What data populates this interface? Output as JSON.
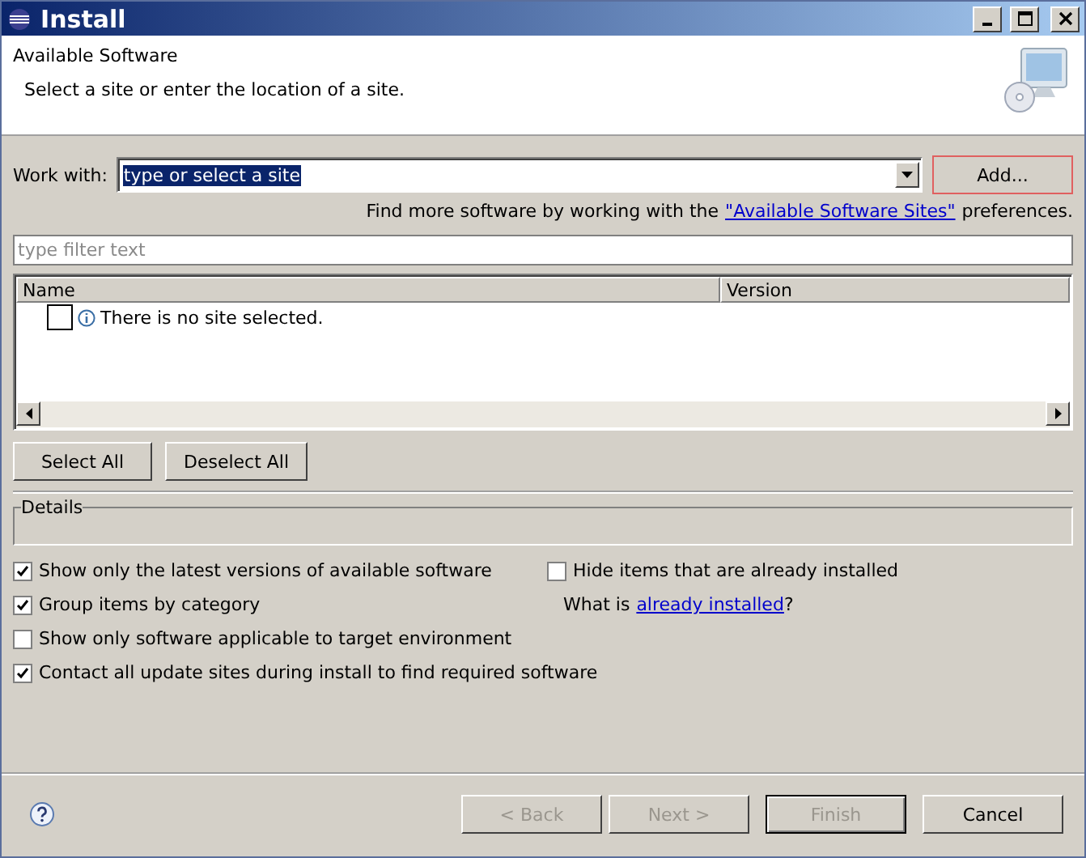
{
  "window": {
    "title": "Install"
  },
  "header": {
    "title": "Available Software",
    "description": "Select a site or enter the location of a site."
  },
  "work_with": {
    "label": "Work with:",
    "value": "type or select a site",
    "add_button": "Add..."
  },
  "more_software": {
    "before": "Find more software by working with the",
    "link": "\"Available Software Sites\"",
    "after": "preferences."
  },
  "filter": {
    "placeholder": "type filter text"
  },
  "table": {
    "columns": [
      "Name",
      "Version"
    ],
    "rows": [
      {
        "name": "There is no site selected.",
        "checked": false
      }
    ]
  },
  "selection_buttons": [
    "Select All",
    "Deselect All"
  ],
  "details": {
    "label": "Details"
  },
  "options": [
    {
      "label": "Show only the latest versions of available software",
      "checked": true
    },
    {
      "label": "Hide items that are already installed",
      "checked": false
    },
    {
      "label": "Group items by category",
      "checked": true
    },
    {
      "label": "Show only software applicable to target environment",
      "checked": false
    },
    {
      "label": "Contact all update sites during install to find required software",
      "checked": true
    }
  ],
  "installed_note": {
    "before": "What is",
    "link": "already installed",
    "after": "?"
  },
  "buttons": [
    {
      "label": "< Back",
      "disabled": true,
      "default": false
    },
    {
      "label": "Next >",
      "disabled": true,
      "default": false
    },
    {
      "label": "Finish",
      "disabled": true,
      "default": true
    },
    {
      "label": "Cancel",
      "disabled": false,
      "default": false
    }
  ]
}
